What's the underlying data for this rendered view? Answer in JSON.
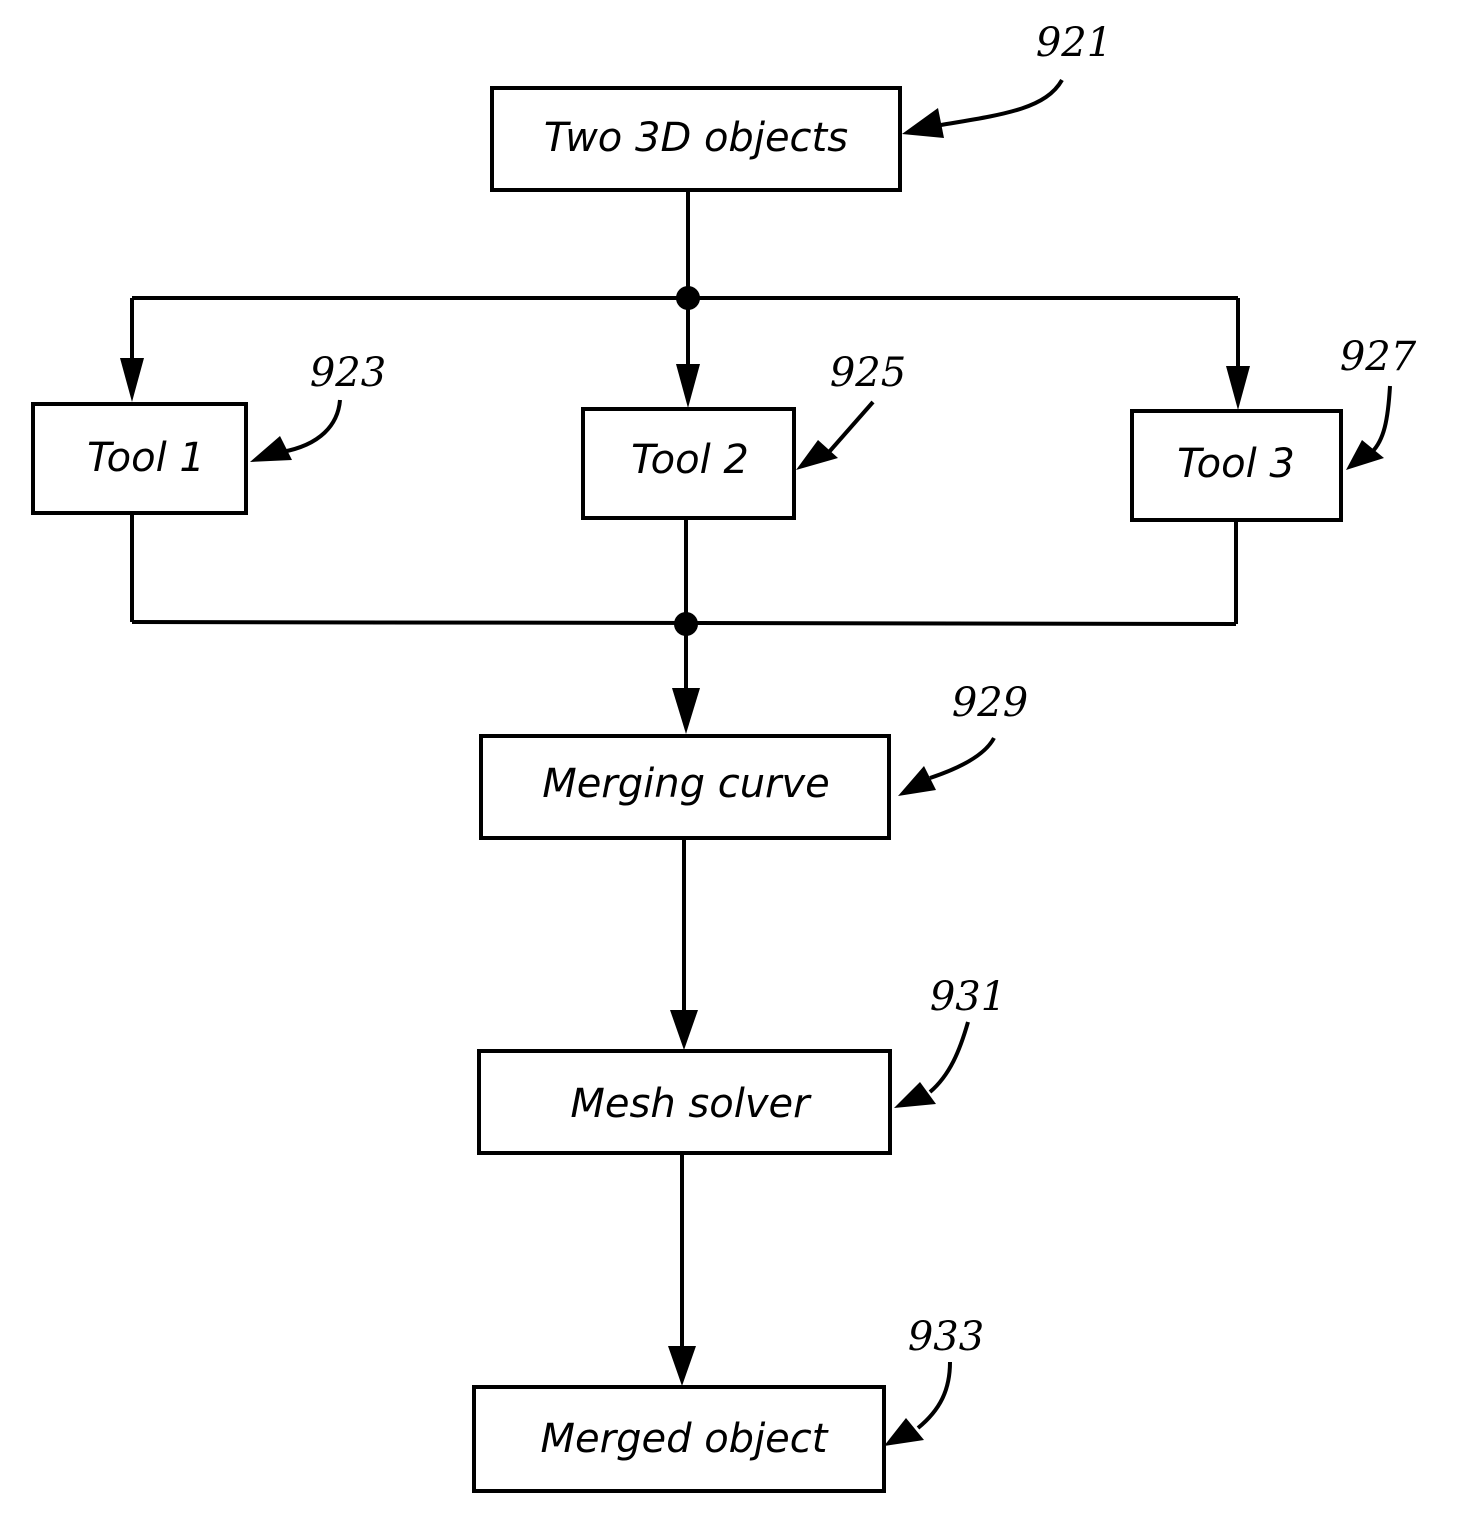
{
  "diagram": {
    "type": "flowchart",
    "nodes": [
      {
        "id": "objects",
        "label": "Two 3D objects",
        "ref": "921"
      },
      {
        "id": "tool1",
        "label": "Tool 1",
        "ref": "923"
      },
      {
        "id": "tool2",
        "label": "Tool 2",
        "ref": "925"
      },
      {
        "id": "tool3",
        "label": "Tool 3",
        "ref": "927"
      },
      {
        "id": "merging",
        "label": "Merging curve",
        "ref": "929"
      },
      {
        "id": "solver",
        "label": "Mesh solver",
        "ref": "931"
      },
      {
        "id": "merged",
        "label": "Merged object",
        "ref": "933"
      }
    ],
    "edges": [
      {
        "from": "objects",
        "to": "tool1"
      },
      {
        "from": "objects",
        "to": "tool2"
      },
      {
        "from": "objects",
        "to": "tool3"
      },
      {
        "from": "tool1",
        "to": "merging"
      },
      {
        "from": "tool2",
        "to": "merging"
      },
      {
        "from": "tool3",
        "to": "merging"
      },
      {
        "from": "merging",
        "to": "solver"
      },
      {
        "from": "solver",
        "to": "merged"
      }
    ]
  }
}
